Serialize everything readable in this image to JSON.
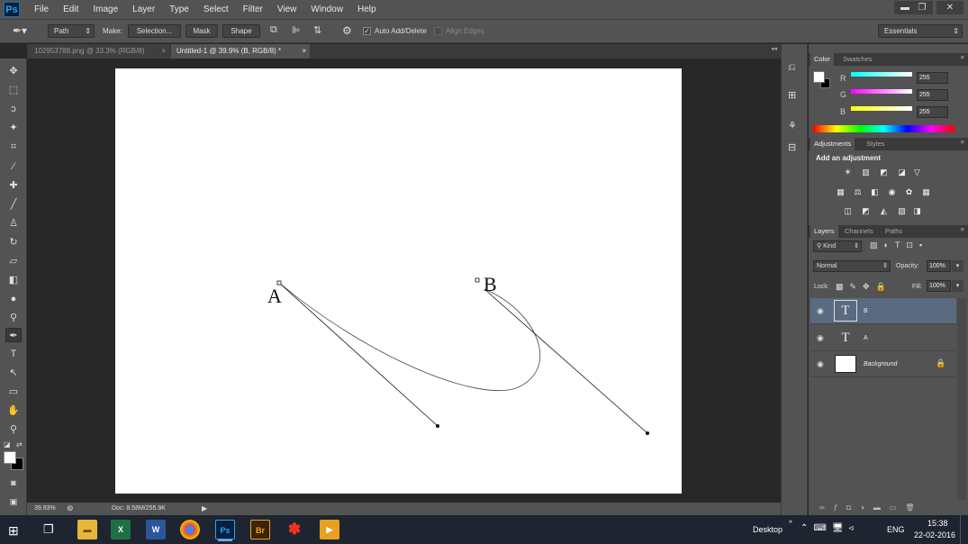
{
  "app": {
    "logo": "Ps"
  },
  "menu": [
    "File",
    "Edit",
    "Image",
    "Layer",
    "Type",
    "Select",
    "Filter",
    "View",
    "Window",
    "Help"
  ],
  "window_controls": {
    "minimize": "▬",
    "restore": "❐",
    "close": "✕"
  },
  "options": {
    "tool_mode": "Path",
    "make_label": "Make:",
    "selection_btn": "Selection...",
    "mask_btn": "Mask",
    "shape_btn": "Shape",
    "auto_add_delete": "Auto Add/Delete",
    "align_edges": "Align Edges",
    "workspace": "Essentials"
  },
  "doc_tabs": [
    {
      "label": "102953788.png @ 33.3% (RGB/8)",
      "close": "×"
    },
    {
      "label": "Untitled-1 @ 39.9% (B, RGB/8) *",
      "close": "×"
    }
  ],
  "canvas_text": {
    "a": "A",
    "b": "B"
  },
  "status": {
    "zoom": "39.93%",
    "doc": "Doc: 8.58M/255.9K"
  },
  "color_panel": {
    "tabs": [
      "Color",
      "Swatches"
    ],
    "r_label": "R",
    "g_label": "G",
    "b_label": "B",
    "r": "255",
    "g": "255",
    "b": "255"
  },
  "adjust_panel": {
    "tabs": [
      "Adjustments",
      "Styles"
    ],
    "title": "Add an adjustment"
  },
  "layers_panel": {
    "tabs": [
      "Layers",
      "Channels",
      "Paths"
    ],
    "kind": "Kind",
    "blend": "Normal",
    "opacity_label": "Opacity:",
    "opacity": "100%",
    "lock_label": "Lock:",
    "fill_label": "Fill:",
    "fill": "100%",
    "layers": [
      {
        "name": "B",
        "type_icon": "T"
      },
      {
        "name": "A",
        "type_icon": "T"
      },
      {
        "name": "Background"
      }
    ]
  },
  "taskbar": {
    "desktop": "Desktop",
    "lang": "ENG",
    "time": "15:38",
    "date": "22-02-2016",
    "apps": {
      "excel": "X",
      "word": "W",
      "ps": "Ps",
      "br": "Br"
    }
  },
  "colors": {
    "ps_blue": "#2fa3f7",
    "canvas": "#ffffff",
    "selected_layer": "#5a6a80"
  }
}
